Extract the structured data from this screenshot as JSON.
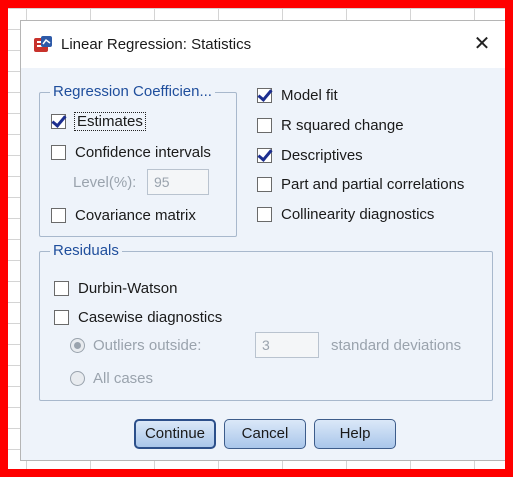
{
  "dialog": {
    "title": "Linear Regression: Statistics",
    "close_symbol": "✕"
  },
  "regression_coefficients": {
    "legend": "Regression Coefficien...",
    "estimates": {
      "label": "Estimates",
      "checked": true
    },
    "confidence_intervals": {
      "label": "Confidence intervals",
      "checked": false
    },
    "level_label": "Level(%):",
    "level_value": "95",
    "covariance_matrix": {
      "label": "Covariance matrix",
      "checked": false
    }
  },
  "right_options": {
    "model_fit": {
      "label": "Model fit",
      "checked": true
    },
    "r_squared_change": {
      "label": "R squared change",
      "checked": false
    },
    "descriptives": {
      "label": "Descriptives",
      "checked": true
    },
    "part_partial": {
      "label": "Part and partial correlations",
      "checked": false
    },
    "collinearity": {
      "label": "Collinearity diagnostics",
      "checked": false
    }
  },
  "residuals": {
    "legend": "Residuals",
    "durbin_watson": {
      "label": "Durbin-Watson",
      "checked": false
    },
    "casewise": {
      "label": "Casewise diagnostics",
      "checked": false
    },
    "outliers_outside": {
      "label": "Outliers outside:",
      "selected": true
    },
    "outliers_value": "3",
    "std_dev_label": "standard deviations",
    "all_cases": {
      "label": "All cases",
      "selected": false
    }
  },
  "buttons": {
    "continue": "Continue",
    "cancel": "Cancel",
    "help": "Help"
  },
  "colors": {
    "frame": "#ff0000",
    "legend_text": "#1f4e9c",
    "button_gradient_top": "#dbe8f8",
    "button_gradient_bottom": "#a9c6ea",
    "dialog_bg": "#eef3fa"
  },
  "icons": {
    "app_icon": "spss-regression-icon",
    "close": "close-icon"
  }
}
